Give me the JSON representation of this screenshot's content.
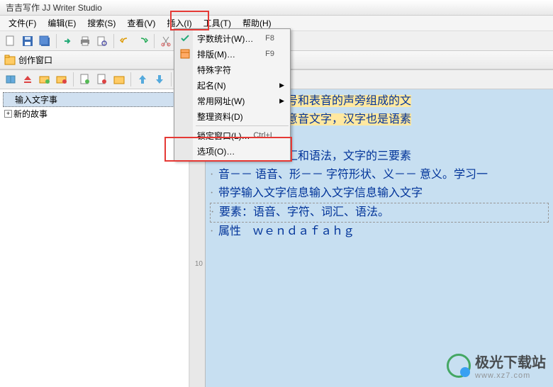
{
  "app_title": "吉吉写作 JJ Writer Studio",
  "menubar": [
    "文件(F)",
    "编辑(E)",
    "搜索(S)",
    "查看(V)",
    "插入(I)",
    "工具(T)",
    "帮助(H)"
  ],
  "panel_header": "创作窗口",
  "tree": {
    "items": [
      "输入文字事",
      "新的故事"
    ]
  },
  "dropdown": {
    "items": [
      {
        "label": "字数统计(W)…",
        "shortcut": "F8",
        "icon": "check"
      },
      {
        "label": "排版(M)…",
        "shortcut": "F9",
        "icon": "layout"
      },
      {
        "label": "特殊字符"
      },
      {
        "label": "起名(N)",
        "submenu": true
      },
      {
        "label": "常用网址(W)",
        "submenu": true
      },
      {
        "label": "整理资料(D)"
      },
      {
        "sep": true
      },
      {
        "label": "锁定窗口(L)…",
        "shortcut": "Ctrl+L"
      },
      {
        "label": "选项(O)…"
      }
    ]
  },
  "editor": {
    "lines": [
      {
        "text": "表义的象形符号和表音的声旁组成的文",
        "hl": true
      },
      {
        "text": "文字进化成的意音文字，汉字也是语素",
        "hl": true
      },
      {
        "text": ""
      },
      {
        "text": "是：语音、词汇和语法，文字的三要素"
      },
      {
        "text": "音－－ 语音、形－－ 字符形状、义－－ 意义。学习一"
      },
      {
        "text": "带学输入文字信息输入文字信息输入文字"
      },
      {
        "text": "要素：语音、字符、词汇、语法。",
        "caret": true
      },
      {
        "text": "属性　ｗｅｎｄａｆａｈｇ"
      }
    ],
    "last_line_number": "10"
  },
  "watermark": {
    "text": "极光下载站",
    "sub": "www.xz7.com"
  }
}
